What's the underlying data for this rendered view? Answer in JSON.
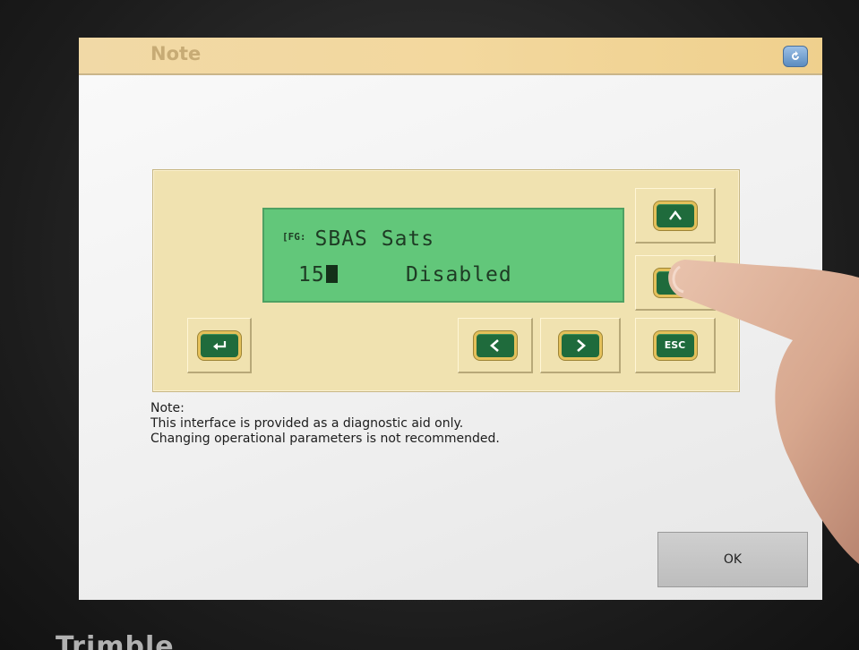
{
  "window": {
    "title": "Note"
  },
  "display": {
    "prefix": "[FG:",
    "row1": "SBAS Sats",
    "row2_value": "15",
    "row2_status": "Disabled"
  },
  "keys": {
    "enter_icon": "enter-arrow-icon",
    "left_icon": "chevron-left-icon",
    "right_icon": "chevron-right-icon",
    "up_icon": "chevron-up-icon",
    "esc_label": "ESC"
  },
  "note": {
    "heading": "Note:",
    "line1": "This interface is provided as a diagnostic aid only.",
    "line2": "Changing operational parameters is not recommended."
  },
  "buttons": {
    "ok_label": "OK"
  },
  "device": {
    "brand": "Trimble"
  },
  "colors": {
    "lcd_green": "#62c77a",
    "key_green": "#1f6b3c",
    "key_border_gold": "#e3c05a",
    "panel_tan": "#f0e2b0",
    "titlebar_tan": "#f3d89e"
  }
}
